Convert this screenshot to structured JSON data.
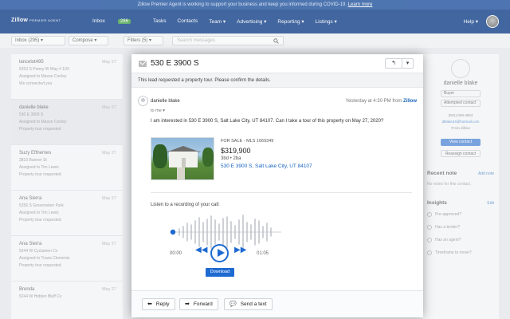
{
  "banner": {
    "text": "Zillow Premier Agent is working to support your business and keep you informed during COVID-19.",
    "link": "Learn more"
  },
  "topnav": {
    "logo": "Zillow",
    "logo_sub": "PREMIER AGENT",
    "items": [
      {
        "label": "Inbox",
        "badge": "286"
      },
      {
        "label": "Tasks"
      },
      {
        "label": "Contacts"
      },
      {
        "label": "Team ▾"
      },
      {
        "label": "Advertising ▾"
      },
      {
        "label": "Reporting ▾"
      },
      {
        "label": "Listings ▾"
      }
    ],
    "help": "Help ▾"
  },
  "toolbar": {
    "inbox_filter": "Inbox (295) ▾",
    "compose": "Compose ▾",
    "filters": "Filters (5) ▾",
    "search_placeholder": "Search messages"
  },
  "message_list": [
    {
      "name": "lancelot495",
      "date": "May 27",
      "lines": [
        "5263 S Penny W Way # 103",
        "Assigned to Mason Conley",
        "We connected you"
      ]
    },
    {
      "name": "danielle blake",
      "date": "May 27",
      "lines": [
        "530 E 3900 S",
        "Assigned to Mason Conley",
        "Property tour requested"
      ]
    },
    {
      "name": "Suzy Efthemes",
      "date": "May 27",
      "lines": [
        "3810 Banner St",
        "Assigned to Tim Lewis",
        "Property tour requested"
      ]
    },
    {
      "name": "Ana Sierra",
      "date": "May 27",
      "lines": [
        "5256 S Gravenstein Park",
        "Assigned to Tim Lewis",
        "Property tour requested"
      ]
    },
    {
      "name": "Ana Sierra",
      "date": "May 27",
      "lines": [
        "5244 W Cyclamen Cv",
        "Assigned to Travis Clements",
        "Property tour requested"
      ]
    },
    {
      "name": "Brenda",
      "date": "May 27",
      "lines": [
        "5244 W Hidden Bluff Cv",
        "",
        ""
      ]
    }
  ],
  "contact": {
    "name": "danielle blake",
    "role": "Buyer",
    "status": "Attempted contact",
    "phone": "(801) 608-4804",
    "email": "dblake24@hotmail.com",
    "source": "From Zillow",
    "view_contact": "View contact",
    "reassign": "Reassign contact",
    "recent_note_title": "Recent note",
    "add_note": "Add note",
    "no_notes": "No notes for this contact.",
    "insights_title": "Insights",
    "edit": "Edit",
    "insights": [
      "Pre-approved?",
      "Has a lender?",
      "Has an agent?",
      "Timeframe to move?"
    ]
  },
  "modal": {
    "title": "530 E 3900 S",
    "reply_icon": "↰",
    "dropdown_icon": "▾",
    "note": "This lead requested a property tour. Please confirm the details.",
    "sender": "danielle blake",
    "to": "to me ▾",
    "time": "Yesterday at 4:30 PM from",
    "via": "Zillow",
    "body": "I am interested in 530 E 3900 S, Salt Lake City, UT 84107. Can I take a tour of this property on May 27, 2020?",
    "listing": {
      "status": "FOR SALE - MLS 1669349",
      "price": "$319,900",
      "beds": "3bd • 2ba",
      "address": "530 E 3900 S, Salt Lake City, UT 84107"
    },
    "listen_label": "Listen to a recording of your call:",
    "time_start": "00:00",
    "time_end": "01:05",
    "download": "Download",
    "footer": {
      "reply": "Reply",
      "forward": "Forward",
      "send_text": "Send a text"
    }
  }
}
